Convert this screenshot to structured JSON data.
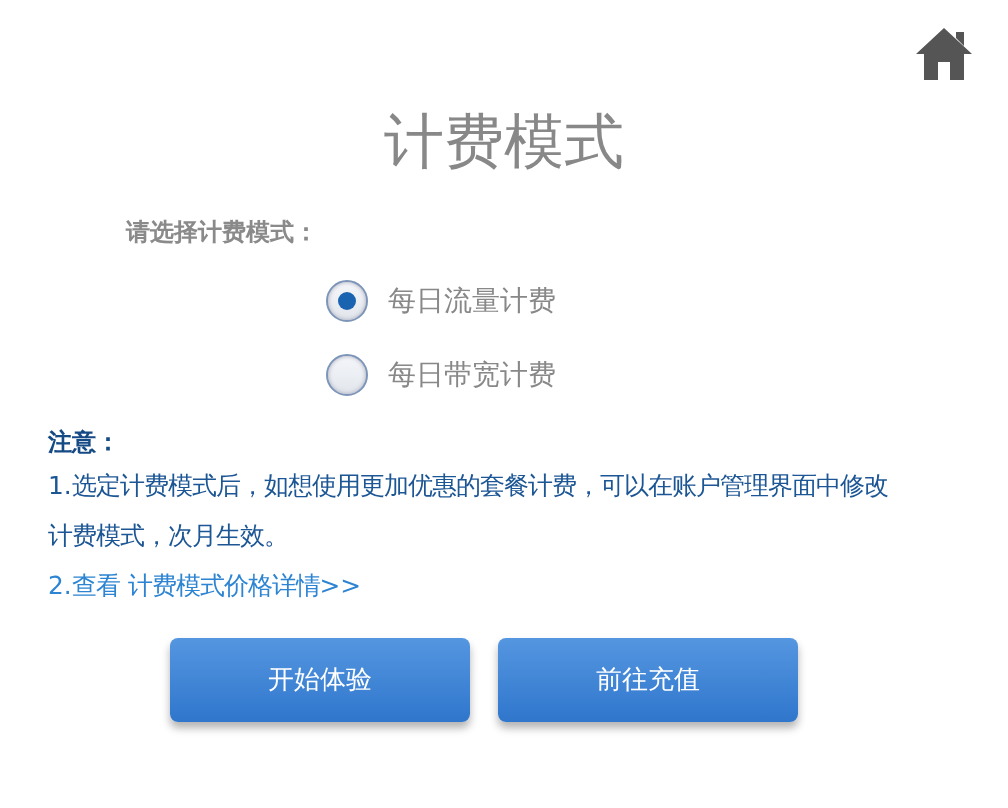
{
  "title": "计费模式",
  "prompt": "请选择计费模式：",
  "options": [
    {
      "label": "每日流量计费",
      "selected": true
    },
    {
      "label": "每日带宽计费",
      "selected": false
    }
  ],
  "notes": {
    "heading": "注意：",
    "items": [
      {
        "kind": "text",
        "text": "1.选定计费模式后，如想使用更加优惠的套餐计费，可以在账户管理界面中修改计费模式，次月生效。"
      },
      {
        "kind": "link",
        "text": "2.查看 ",
        "link": "计费模式价格详情>>"
      }
    ]
  },
  "buttons": [
    "开始体验",
    "前往充值"
  ]
}
